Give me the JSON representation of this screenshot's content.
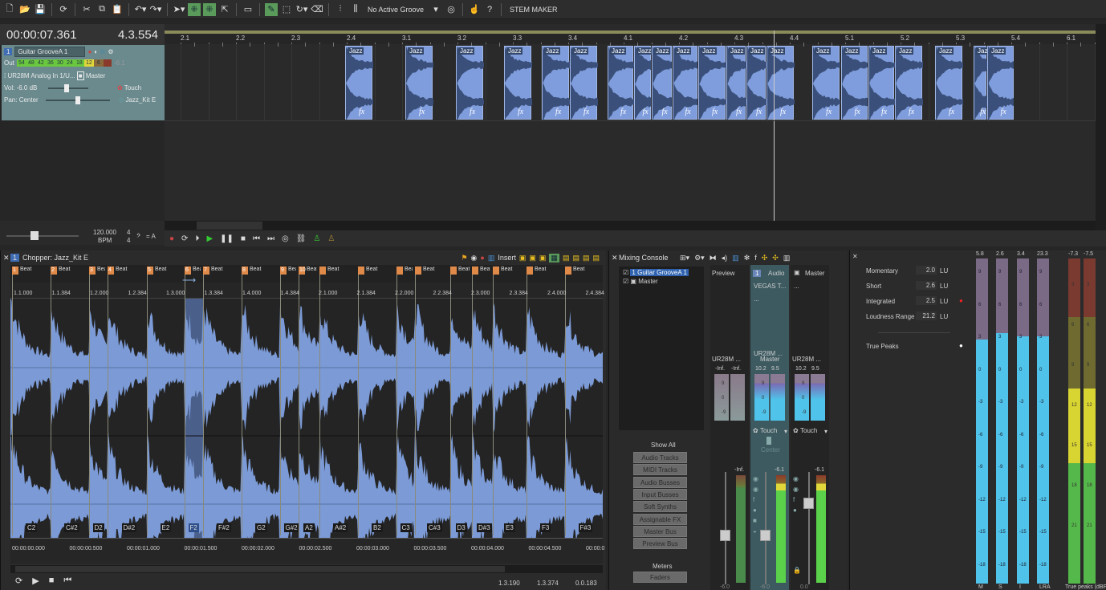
{
  "toolbar": {
    "groove_label": "No Active Groove",
    "stem_maker_label": "STEM MAKER",
    "icons": [
      "new-file-icon",
      "open-folder-icon",
      "save-icon",
      "refresh-icon",
      "cut-icon",
      "copy-icon",
      "paste-icon",
      "undo-icon",
      "redo-icon",
      "select-tool-icon",
      "snap-icon",
      "snap-alt-icon",
      "cursor-icon",
      "monitor-icon",
      "pencil-icon",
      "marquee-icon",
      "loop-icon",
      "eraser-icon",
      "split-icon",
      "align-icon"
    ]
  },
  "time_display": {
    "time": "00:00:07.361",
    "position": "4.3.554"
  },
  "track": {
    "number": "1",
    "name": "Guitar GrooveA 1",
    "out_label": "Out",
    "meter_ticks": [
      "54",
      "48",
      "42",
      "36",
      "30",
      "24",
      "18",
      "12",
      "6"
    ],
    "meter_peak": "-6.1",
    "input": "UR28M Analog In 1/U...",
    "output": "Master",
    "vol_label": "Vol:",
    "vol_value": "-6.0 dB",
    "automation": "Touch",
    "pan_label": "Pan:",
    "pan_value": "Center",
    "clip_name": "Jazz_Kit E",
    "volume_fader": 0.4,
    "pan_position": 0.5
  },
  "ruler_labels": [
    "2.1",
    "2.2",
    "2.3",
    "2.4",
    "3.1",
    "3.2",
    "3.3",
    "3.4",
    "4.1",
    "4.2",
    "4.3",
    "4.4",
    "5.1",
    "5.2",
    "5.3",
    "5.4",
    "6.1"
  ],
  "clip_label": "Jazz",
  "clip_fx": "fx",
  "tempo": {
    "bpm": "120.000",
    "bpm_label": "BPM",
    "meter_top": "4",
    "meter_bottom": "4",
    "key": "= A"
  },
  "chopper": {
    "title": "Chopper: Jazz_Kit E",
    "insert_label": "Insert",
    "markers": [
      "1",
      "2",
      "3",
      "4",
      "5",
      "6",
      "7",
      "8",
      "9",
      "10",
      "",
      "",
      "",
      "",
      "",
      "",
      "",
      "",
      ""
    ],
    "marker_label": "Beat",
    "ruler": [
      "1.1.000",
      "1.1.384",
      "1.2.000",
      "1.2.384",
      "1.3.000",
      "1.3.384",
      "1.4.000",
      "1.4.384",
      "2.1.000",
      "2.1.384",
      "2.2.000",
      "2.2.384",
      "2.3.000",
      "2.3.384",
      "2.4.000",
      "2.4.384"
    ],
    "notes": [
      "C2",
      "C#2",
      "D2",
      "D#2",
      "E2",
      "F2",
      "F#2",
      "G2",
      "G#2",
      "A2",
      "A#2",
      "B2",
      "C3",
      "C#3",
      "D3",
      "D#3",
      "E3",
      "F3",
      "F#3"
    ],
    "times": [
      "00:00:00.000",
      "00:00:00.500",
      "00:00:01.000",
      "00:00:01.500",
      "00:00:02.000",
      "00:00:02.500",
      "00:00:03.000",
      "00:00:03.500",
      "00:00:04.000",
      "00:00:04.500",
      "00:00:0"
    ],
    "selected_note": "F2",
    "status": [
      "1.3.190",
      "1.3.374",
      "0.0.183"
    ]
  },
  "mixer": {
    "title": "Mixing Console",
    "tracks": [
      {
        "num": "1",
        "name": "Guitar GrooveA 1",
        "checked": true
      },
      {
        "name": "Master",
        "checked": true
      }
    ],
    "show_all": "Show All",
    "filters": [
      "Audio Tracks",
      "MIDI Tracks",
      "Audio Busses",
      "Input Busses",
      "Soft Synths",
      "Assignable FX",
      "Master Bus",
      "Preview Bus"
    ],
    "meters_label": "Meters",
    "faders_label": "Faders",
    "strips": [
      {
        "title": "Preview",
        "input": "",
        "output": "UR28M ...",
        "peaks": [
          "-Inf.",
          "-Inf."
        ],
        "meter_peak": "-Inf.",
        "fader_value": "-6.0",
        "automation": ""
      },
      {
        "num": "1",
        "title": "Audio",
        "input": "VEGAS T...",
        "sub": "...",
        "in_port": "UR28M ...",
        "output": "Master",
        "peaks": [
          "10.2",
          "9.5"
        ],
        "automation": "Touch",
        "pan": "Center",
        "meter_peak": "-6.1",
        "fader_value": "-6.0"
      },
      {
        "title": "Master",
        "input": "...",
        "output": "UR28M ...",
        "peaks": [
          "10.2",
          "9.5"
        ],
        "automation": "Touch",
        "meter_peak": "-6.1",
        "fader_value": "0.0"
      }
    ],
    "scale": [
      "9",
      "0",
      "-9"
    ]
  },
  "loudness": {
    "rows": [
      {
        "label": "Momentary",
        "value": "2.0",
        "unit": "LU"
      },
      {
        "label": "Short",
        "value": "2.6",
        "unit": "LU"
      },
      {
        "label": "Integrated",
        "value": "2.5",
        "unit": "LU"
      },
      {
        "label": "Loudness Range",
        "value": "21.2",
        "unit": "LU"
      }
    ],
    "true_peaks_label": "True Peaks",
    "meters": [
      {
        "name": "M",
        "peak": "5.8",
        "level": 0.75
      },
      {
        "name": "S",
        "peak": "2.6",
        "level": 0.77
      },
      {
        "name": "I",
        "peak": "3.4",
        "level": 0.76
      },
      {
        "name": "LRA",
        "peak": "23.3",
        "level": 0.76
      }
    ],
    "scale": [
      "9",
      "6",
      "3",
      "0",
      "-3",
      "-6",
      "-9",
      "-12",
      "-15",
      "-18"
    ],
    "tp_meters": [
      {
        "peak": "-7.3"
      },
      {
        "peak": "-7.5"
      }
    ],
    "tp_scale": [
      "3",
      "6",
      "9",
      "12",
      "15",
      "18",
      "21"
    ],
    "tp_label": "True peaks (dBFS)",
    "colors": {
      "loudness": "#4fc3ea",
      "over": "#7a6a86",
      "tp_red": "#7a3a30",
      "tp_olive": "#6e6a30",
      "tp_yellow": "#d8d431",
      "tp_green": "#55b84a"
    }
  }
}
